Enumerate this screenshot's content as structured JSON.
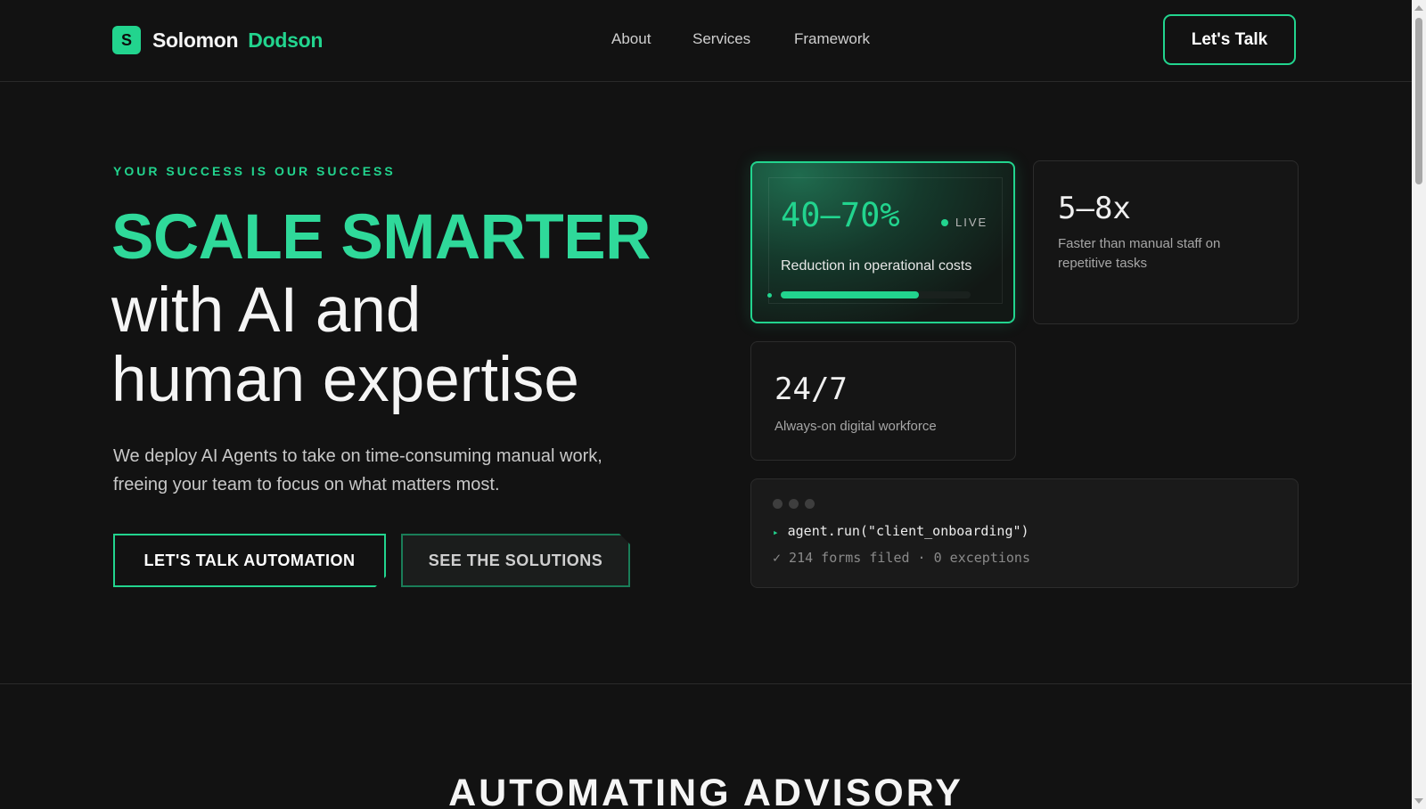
{
  "brand": {
    "mark": "S",
    "first": "Solomon",
    "last": "Dodson"
  },
  "nav": {
    "items": [
      "About",
      "Services",
      "Framework"
    ],
    "cta": "Let's Talk"
  },
  "hero": {
    "eyebrow": "YOUR SUCCESS IS OUR SUCCESS",
    "headline_accent": "SCALE SMARTER",
    "headline_line2": "with AI and",
    "headline_line3": "human expertise",
    "subtext": "We deploy AI Agents to take on time-consuming manual work, freeing your team to focus on what matters most.",
    "primary_cta": "LET'S TALK AUTOMATION",
    "secondary_cta": "SEE THE SOLUTIONS"
  },
  "stats": {
    "featured": {
      "value": "40–70%",
      "badge": "LIVE",
      "label": "Reduction in operational costs",
      "progress_fraction": 0.73
    },
    "speed": {
      "value": "5–8x",
      "label": "Faster than manual staff on repetitive tasks"
    },
    "availability": {
      "value": "24/7",
      "label": "Always-on digital workforce"
    }
  },
  "terminal": {
    "command": "agent.run(\"client_onboarding\")",
    "output": "✓ 214 forms filed · 0 exceptions"
  },
  "next_section": {
    "title": "AUTOMATING ADVISORY"
  },
  "colors": {
    "accent": "#22d48e",
    "background": "#121212",
    "card": "#151515"
  }
}
